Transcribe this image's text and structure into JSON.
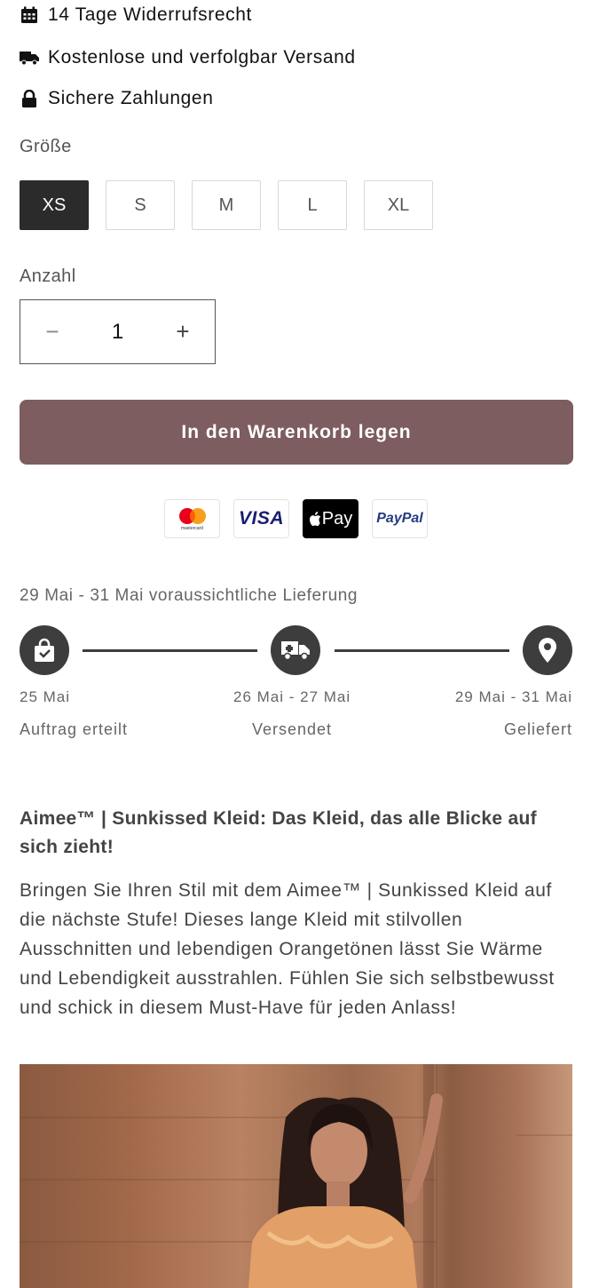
{
  "features": [
    {
      "icon": "calendar-icon",
      "text": "14 Tage Widerrufsrecht"
    },
    {
      "icon": "truck-icon",
      "text": "Kostenlose und verfolgbar Versand"
    },
    {
      "icon": "lock-icon",
      "text": "Sichere Zahlungen"
    }
  ],
  "size": {
    "label": "Größe",
    "options": [
      "XS",
      "S",
      "M",
      "L",
      "XL"
    ],
    "selected": "XS"
  },
  "quantity": {
    "label": "Anzahl",
    "minus": "−",
    "value": "1",
    "plus": "+"
  },
  "cart_button": "In den Warenkorb legen",
  "payment": {
    "mastercard_text": "mastercard",
    "visa": "VISA",
    "applepay": "Pay",
    "paypal": "PayPal"
  },
  "delivery": {
    "estimate": "29 Mai - 31 Mai voraussichtliche Lieferung",
    "steps": [
      {
        "date": "25 Mai",
        "label": "Auftrag erteilt",
        "icon": "lock-bag-icon"
      },
      {
        "date": "26 Mai - 27 Mai",
        "label": "Versendet",
        "icon": "truck-icon"
      },
      {
        "date": "29 Mai - 31 Mai",
        "label": "Geliefert",
        "icon": "location-pin-icon"
      }
    ]
  },
  "description": {
    "title": "Aimee™ | Sunkissed Kleid: Das Kleid, das alle Blicke auf sich zieht!",
    "body": "Bringen Sie Ihren Stil mit dem Aimee™ | Sunkissed Kleid auf die nächste Stufe! Dieses lange Kleid mit stilvollen Ausschnitten und lebendigen Orangetönen lässt Sie Wärme und Lebendigkeit ausstrahlen. Fühlen Sie sich selbstbewusst und schick in diesem Must-Have für jeden Anlass!"
  },
  "colors": {
    "cart_button": "#7d5d5f",
    "selected_size": "#2b2b2b",
    "timeline": "#3d3d3d"
  }
}
